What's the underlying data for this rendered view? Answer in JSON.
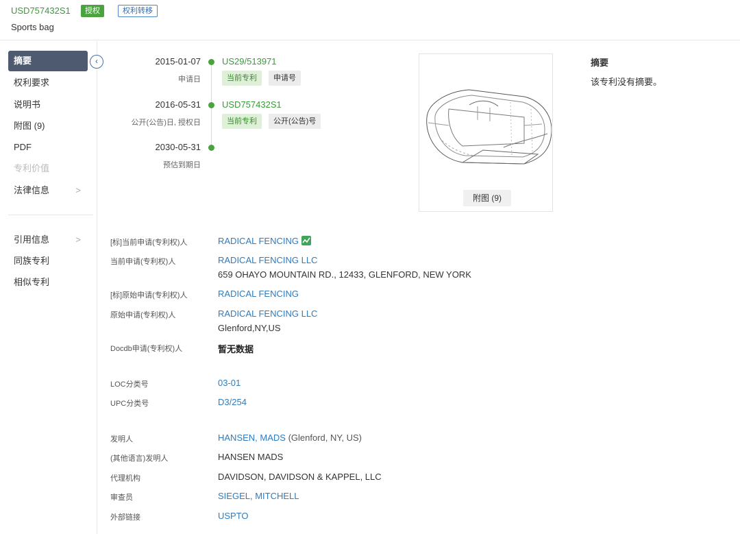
{
  "header": {
    "patent_number": "USD757432S1",
    "status_badge": "授权",
    "transfer_badge": "权利转移",
    "title": "Sports bag"
  },
  "sidebar": {
    "items": [
      {
        "label": "摘要",
        "active": true
      },
      {
        "label": "权利要求"
      },
      {
        "label": "说明书"
      },
      {
        "label": "附图 (9)"
      },
      {
        "label": "PDF"
      },
      {
        "label": "专利价值",
        "disabled": true
      },
      {
        "label": "法律信息",
        "arrow": ">"
      },
      {
        "label": "引用信息",
        "arrow": ">"
      },
      {
        "label": "同族专利"
      },
      {
        "label": "相似专利"
      }
    ],
    "collapse_glyph": "‹"
  },
  "timeline": [
    {
      "date": "2015-01-07",
      "sub": "申请日",
      "number": "US29/513971",
      "tags": [
        "当前专利",
        "申请号"
      ]
    },
    {
      "date": "2016-05-31",
      "sub": "公开(公告)日, 授权日",
      "number": "USD757432S1",
      "tags": [
        "当前专利",
        "公开(公告)号"
      ]
    },
    {
      "date": "2030-05-31",
      "sub": "预估到期日"
    }
  ],
  "figure": {
    "button_label": "附图 (9)"
  },
  "abstract": {
    "title": "摘要",
    "text": "该专利没有摘要。"
  },
  "info": {
    "std_current_applicant": {
      "label": "[标]当前申请(专利权)人",
      "value": "RADICAL FENCING"
    },
    "current_applicant": {
      "label": "当前申请(专利权)人",
      "value": "RADICAL FENCING LLC",
      "address": "659 OHAYO MOUNTAIN RD., 12433, GLENFORD, NEW YORK"
    },
    "std_original_applicant": {
      "label": "[标]原始申请(专利权)人",
      "value": "RADICAL FENCING"
    },
    "original_applicant": {
      "label": "原始申请(专利权)人",
      "value": "RADICAL FENCING LLC",
      "address": "Glenford,NY,US"
    },
    "docdb_applicant": {
      "label": "Docdb申请(专利权)人",
      "value": "暂无数据"
    },
    "loc": {
      "label": "LOC分类号",
      "value": "03-01"
    },
    "upc": {
      "label": "UPC分类号",
      "value": "D3/254"
    },
    "inventor": {
      "label": "发明人",
      "value": "HANSEN, MADS",
      "note": " (Glenford, NY, US)"
    },
    "inventor_other": {
      "label": "(其他语言)发明人",
      "value": "HANSEN MADS"
    },
    "agency": {
      "label": "代理机构",
      "value": "DAVIDSON, DAVIDSON & KAPPEL, LLC"
    },
    "examiner": {
      "label": "审查员",
      "value": "SIEGEL, MITCHELL"
    },
    "external_link": {
      "label": "外部链接",
      "value": "USPTO"
    }
  },
  "colors": {
    "accent_green": "#4aa33f",
    "link_blue": "#2e7bbf",
    "active_nav": "#4e5a70"
  }
}
